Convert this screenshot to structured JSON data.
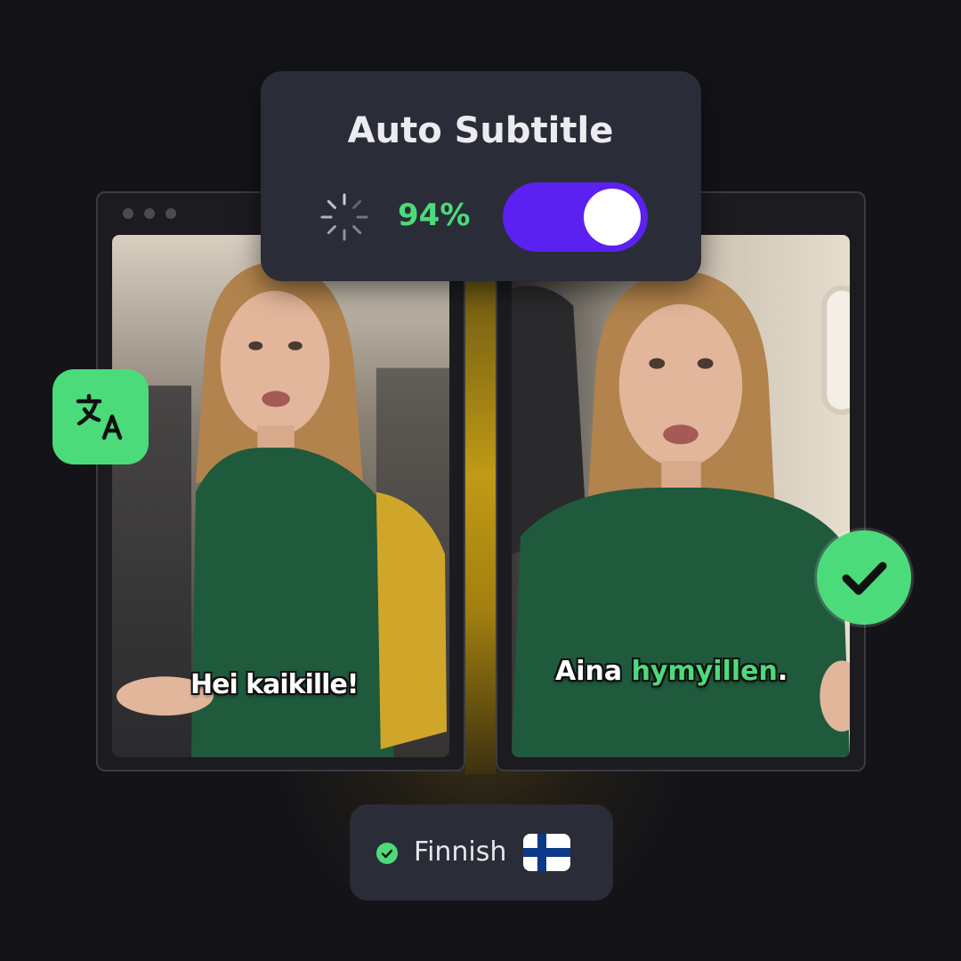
{
  "card": {
    "title": "Auto Subtitle",
    "progress_text": "94%",
    "progress": 0.94,
    "toggle_on": true,
    "toggle_color": "#5a21f0",
    "spinner_icon": "loading-spinner-icon"
  },
  "windows": {
    "left": {
      "subtitle": "Hei kaikille!"
    },
    "right": {
      "subtitle_plain": "Aina",
      "subtitle_highlight": "hymyillen",
      "subtitle_tail": "."
    }
  },
  "badges": {
    "translate_icon": "translate-icon",
    "check_icon": "checkmark-icon"
  },
  "language": {
    "name": "Finnish",
    "selected": true,
    "flag": "finland-flag-icon"
  },
  "colors": {
    "accent_green": "#4cdb7a",
    "accent_purple": "#5a21f0",
    "card_bg": "#2a2d38",
    "page_bg": "#141418"
  }
}
